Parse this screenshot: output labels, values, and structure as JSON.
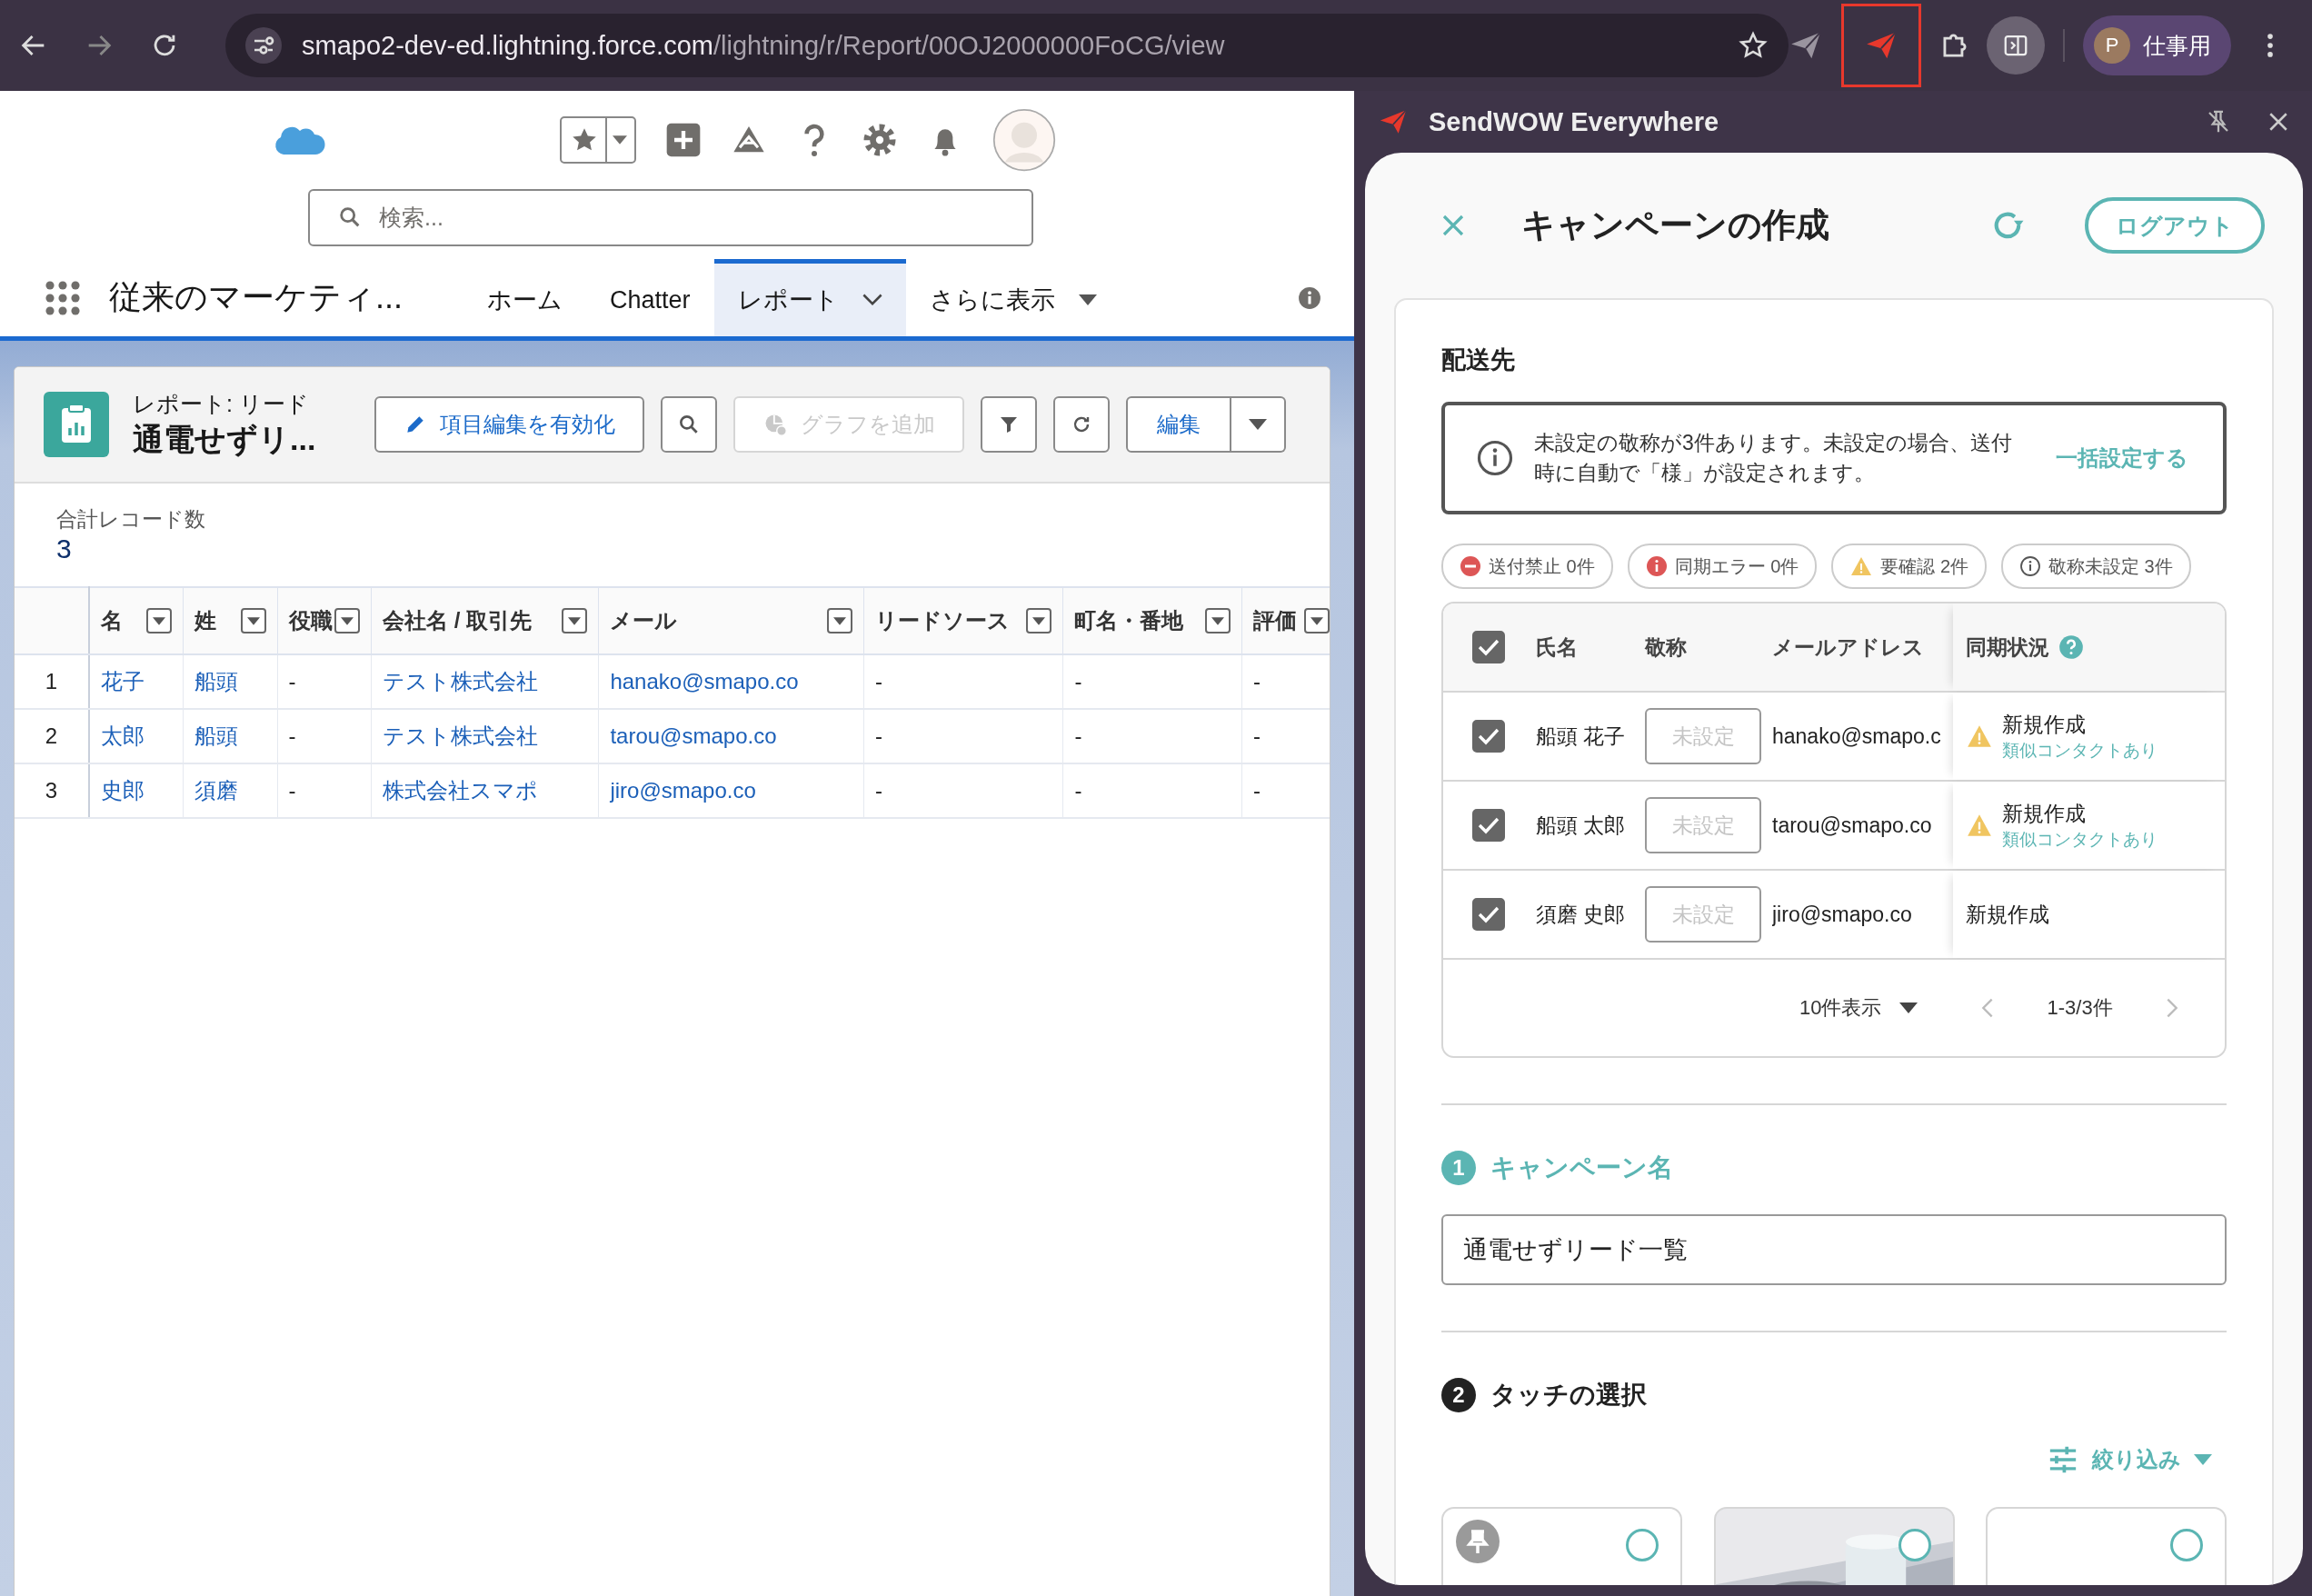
{
  "browser": {
    "url_host": "smapo2-dev-ed.lightning.force.com",
    "url_path": "/lightning/r/Report/00OJ2000000FoCG/view",
    "profile_initial": "P",
    "profile_name": "仕事用"
  },
  "salesforce": {
    "search_placeholder": "検索...",
    "app_name": "従来のマーケティ...",
    "nav_tabs": [
      {
        "label": "ホーム",
        "kind": "plain",
        "selected": false
      },
      {
        "label": "Chatter",
        "kind": "plain",
        "selected": false
      },
      {
        "label": "レポート",
        "kind": "dropdown",
        "selected": true
      },
      {
        "label": "さらに表示",
        "kind": "more",
        "selected": false
      }
    ],
    "report": {
      "type_label": "レポート: リード",
      "title": "通電せずリ...",
      "edit_fields_button": "項目編集を有効化",
      "add_chart_button": {
        "label": "グラフを追加",
        "disabled": true
      },
      "edit_button": "編集"
    },
    "record_count_label": "合計レコード数",
    "record_count": "3",
    "table": {
      "columns": [
        {
          "label": "名",
          "kind": "link"
        },
        {
          "label": "姓",
          "kind": "link"
        },
        {
          "label": "役職",
          "kind": "text"
        },
        {
          "label": "会社名 / 取引先",
          "kind": "link"
        },
        {
          "label": "メール",
          "kind": "link"
        },
        {
          "label": "リードソース",
          "kind": "text"
        },
        {
          "label": "町名・番地",
          "kind": "text"
        },
        {
          "label": "評価",
          "kind": "text"
        }
      ],
      "rows": [
        {
          "number": "1",
          "cells": [
            "花子",
            "船頭",
            "-",
            "テスト株式会社",
            "hanako@smapo.co",
            "-",
            "-",
            "-"
          ]
        },
        {
          "number": "2",
          "cells": [
            "太郎",
            "船頭",
            "-",
            "テスト株式会社",
            "tarou@smapo.co",
            "-",
            "-",
            "-"
          ]
        },
        {
          "number": "3",
          "cells": [
            "史郎",
            "須磨",
            "-",
            "株式会社スマポ",
            "jiro@smapo.co",
            "-",
            "-",
            "-"
          ]
        }
      ]
    }
  },
  "side_panel": {
    "title": "SendWOW Everywhere",
    "heading": "キャンペーンの作成",
    "logout_button": "ログアウト",
    "section_title": "配送先",
    "notice": "未設定の敬称が3件あります。未設定の場合、送付時に自動で「様」が設定されます。",
    "notice_action": "一括設定する",
    "chips": [
      {
        "kind": "blocked",
        "label": "送付禁止 0件"
      },
      {
        "kind": "error",
        "label": "同期エラー 0件"
      },
      {
        "kind": "warning",
        "label": "要確認 2件"
      },
      {
        "kind": "info",
        "label": "敬称未設定 3件"
      }
    ],
    "table": {
      "columns": [
        "氏名",
        "敬称",
        "メールアドレス",
        "同期状況"
      ],
      "all_checked": true,
      "rows": [
        {
          "checked": true,
          "name": "船頭 花子",
          "honorific_placeholder": "未設定",
          "email": "hanako@smapo.c",
          "status": "新規作成",
          "warning": true,
          "note": "類似コンタクトあり"
        },
        {
          "checked": true,
          "name": "船頭 太郎",
          "honorific_placeholder": "未設定",
          "email": "tarou@smapo.co",
          "status": "新規作成",
          "warning": true,
          "note": "類似コンタクトあり"
        },
        {
          "checked": true,
          "name": "須磨 史郎",
          "honorific_placeholder": "未設定",
          "email": "jiro@smapo.co",
          "status": "新規作成",
          "warning": false
        }
      ],
      "page_size": "10件表示",
      "range": "1-3/3件"
    },
    "steps": [
      {
        "number": "1",
        "title": "キャンペーン名",
        "active": true
      },
      {
        "number": "2",
        "title": "タッチの選択",
        "active": false
      }
    ],
    "campaign_name": "通電せずリード一覧",
    "filter_button": "絞り込み",
    "touch_cards": [
      {
        "kind": "pinned",
        "selected": false
      },
      {
        "kind": "picture",
        "selected": false
      },
      {
        "kind": "blank",
        "selected": false
      }
    ]
  }
}
